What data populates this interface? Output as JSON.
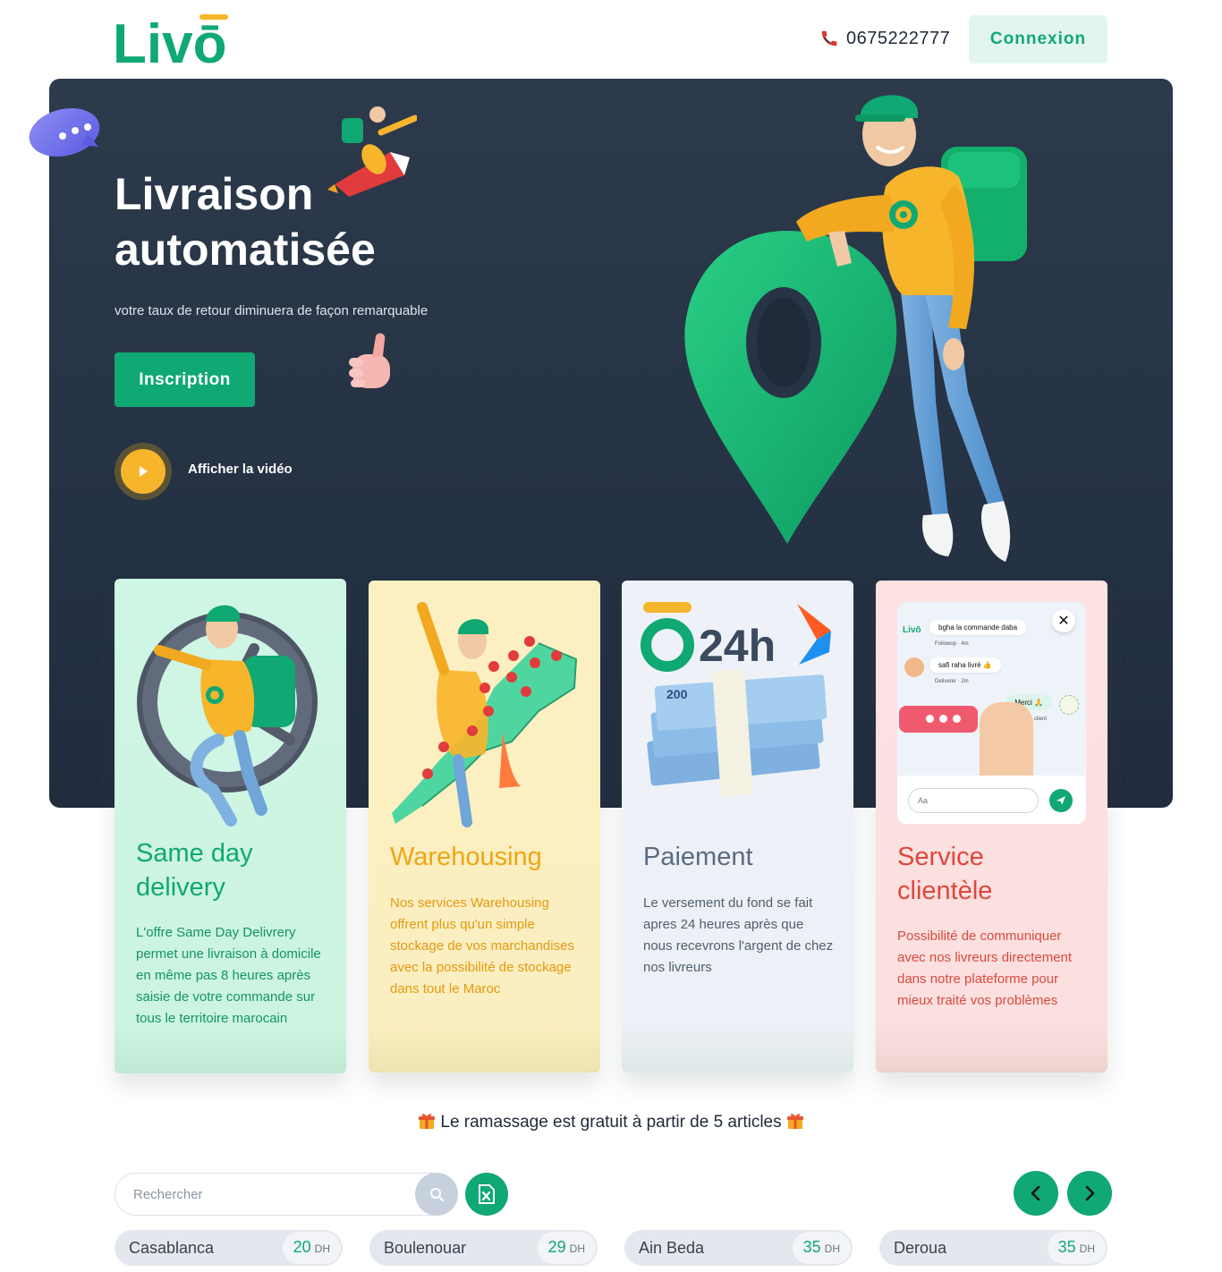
{
  "header": {
    "logo_text": "Livō",
    "phone": "0675222777",
    "connexion_label": "Connexion"
  },
  "hero": {
    "title_line1": "Livraison",
    "title_line2": "automatisée",
    "subtitle": "votre taux de retour diminuera de façon remarquable",
    "inscription_label": "Inscription",
    "video_label": "Afficher la vidéo"
  },
  "cards": [
    {
      "title_line1": "Same day",
      "title_line2": "delivery",
      "text": "L'offre Same Day Delivrery permet une livraison à domicile en même pas 8 heures après saisie de votre commande sur tous le territoire marocain"
    },
    {
      "title_line1": "Warehousing",
      "title_line2": "",
      "text": "Nos services Warehousing offrent plus qu'un simple stockage de vos marchandises avec la possibilité de stockage dans tout le Maroc"
    },
    {
      "title_line1": "Paiement",
      "title_line2": "",
      "text": "Le versement du fond se fait apres 24 heures après que nous recevrons l'argent de chez nos livreurs",
      "badge": "24h",
      "bill_value": "200"
    },
    {
      "title_line1": "Service",
      "title_line2": "clientèle",
      "text": "Possibilité de communiquer avec nos livreurs directement dans notre plateforme pour mieux traité vos problèmes",
      "chat": {
        "msg1": "bgha la commande daba",
        "meta1": "Followup · 4m",
        "msg2": "safi raha livré 👍",
        "meta2": "Deliverer · 2m",
        "msg3": "Merci 🙏",
        "meta3": "2m · client",
        "input_placeholder": "Aa",
        "mini_logo": "Livō"
      }
    }
  ],
  "promo": "Le ramassage est gratuit à partir de 5 articles",
  "search": {
    "placeholder": "Rechercher"
  },
  "cities": [
    {
      "name": "Casablanca",
      "price": "20",
      "unit": "DH"
    },
    {
      "name": "Boulenouar",
      "price": "29",
      "unit": "DH"
    },
    {
      "name": "Ain Beda",
      "price": "35",
      "unit": "DH"
    },
    {
      "name": "Deroua",
      "price": "35",
      "unit": "DH"
    }
  ],
  "colors": {
    "brand_green": "#10a873",
    "hero_bg": "#283548",
    "accent_yellow": "#f7b52b"
  }
}
